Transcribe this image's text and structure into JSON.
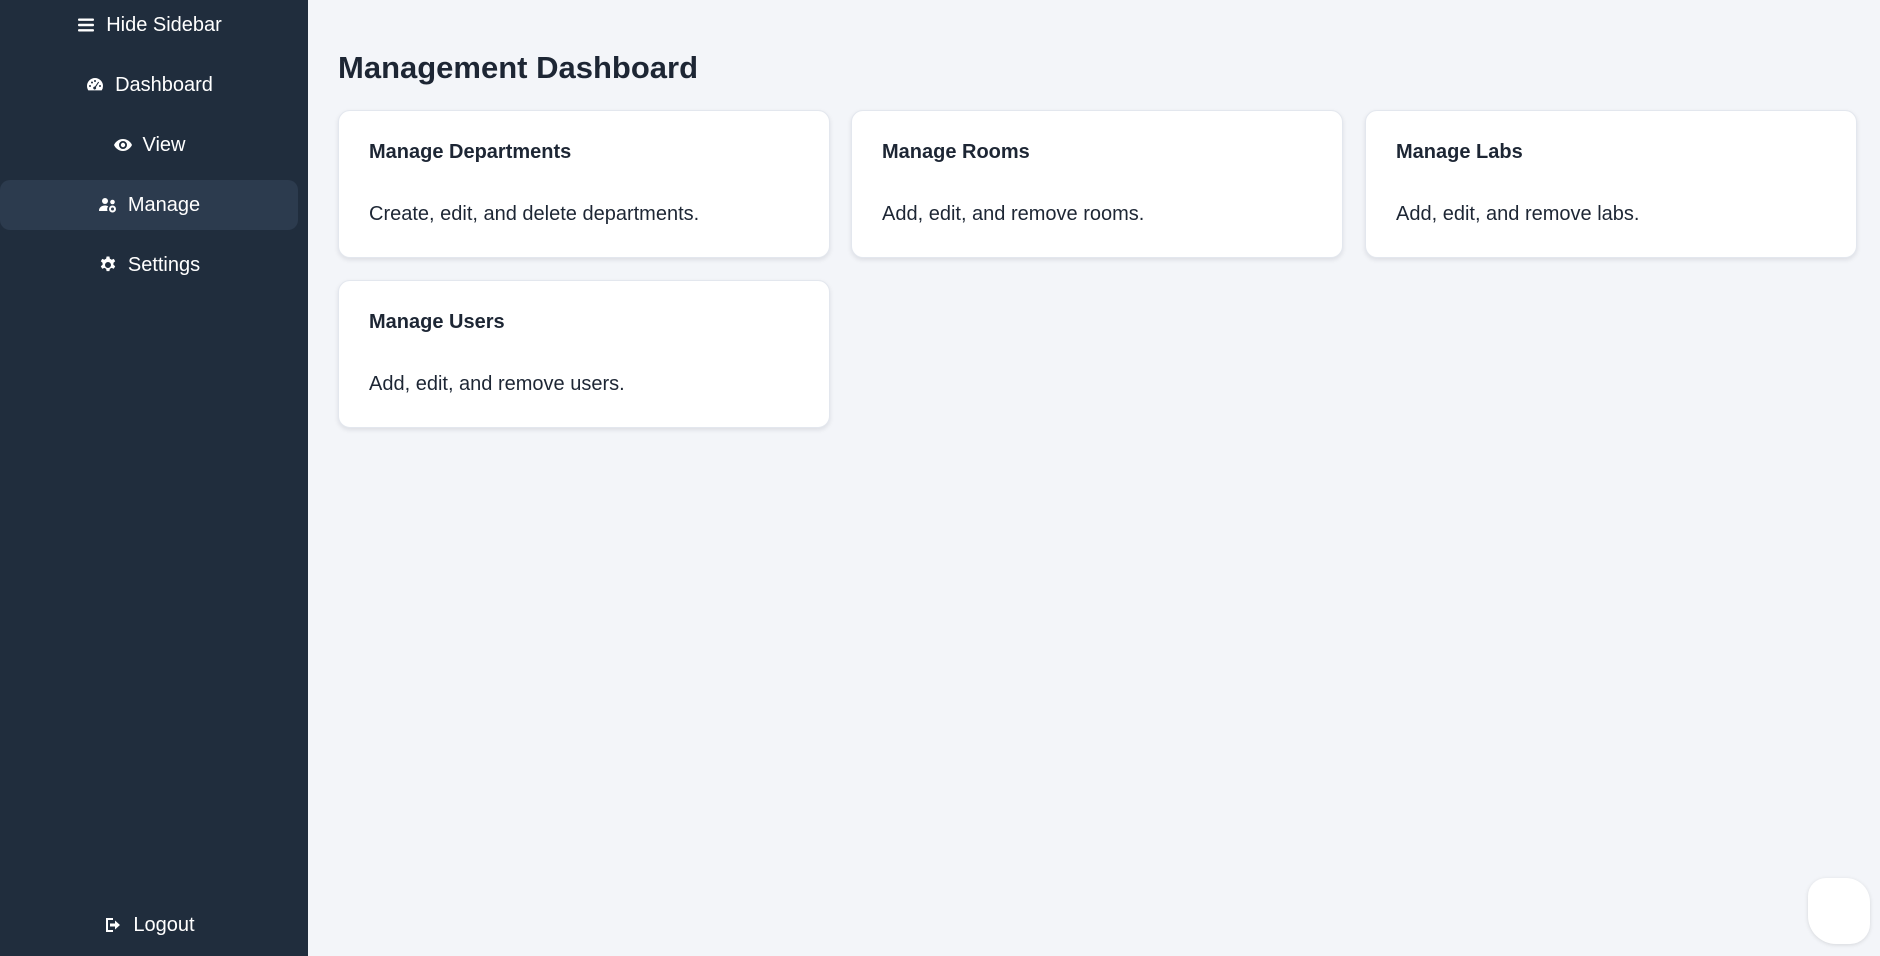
{
  "sidebar": {
    "toggle_label": "Hide Sidebar",
    "items": [
      {
        "label": "Dashboard",
        "icon": "gauge-icon",
        "active": false
      },
      {
        "label": "View",
        "icon": "eye-icon",
        "active": false
      },
      {
        "label": "Manage",
        "icon": "users-cog-icon",
        "active": true
      },
      {
        "label": "Settings",
        "icon": "gear-icon",
        "active": false
      }
    ],
    "logout_label": "Logout"
  },
  "main": {
    "title": "Management Dashboard",
    "cards": [
      {
        "title": "Manage Departments",
        "description": "Create, edit, and delete departments."
      },
      {
        "title": "Manage Rooms",
        "description": "Add, edit, and remove rooms."
      },
      {
        "title": "Manage Labs",
        "description": "Add, edit, and remove labs."
      },
      {
        "title": "Manage Users",
        "description": "Add, edit, and remove users."
      }
    ]
  },
  "colors": {
    "sidebar_bg": "#202d3d",
    "sidebar_active_bg": "#2c3b4e",
    "page_bg": "#f3f5f9",
    "card_bg": "#ffffff",
    "text_dark": "#1d2634"
  }
}
